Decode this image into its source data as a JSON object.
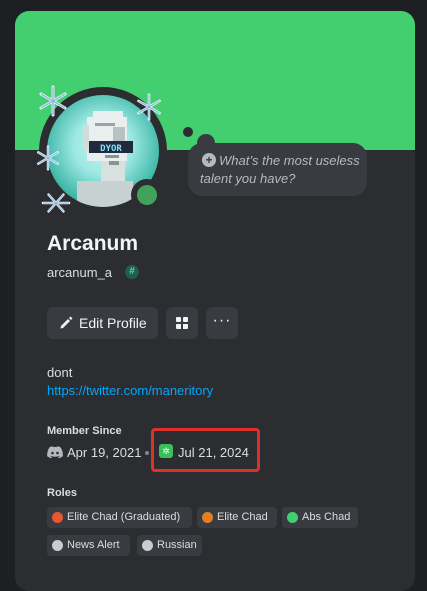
{
  "profile": {
    "display_name": "Arcanum",
    "username": "arcanum_a",
    "username_badge_icon": "hash-badge-icon",
    "status_color": "#43a25a",
    "banner_color": "#43cf70",
    "avatar_text": "DYOR"
  },
  "bubble": {
    "placeholder": "What’s the most useless talent you have?"
  },
  "buttons": {
    "edit_profile": "Edit Profile",
    "more": "···"
  },
  "bio": {
    "text": "dont",
    "link": "https://twitter.com/maneritory"
  },
  "member_since": {
    "title": "Member Since",
    "discord_date": "Apr 19, 2021",
    "server_date": "Jul 21, 2024",
    "highlight_color": "#e0302a"
  },
  "roles": {
    "title": "Roles",
    "items": [
      {
        "label": "Elite Chad (Graduated)",
        "color": "#e8572f"
      },
      {
        "label": "Elite Chad",
        "color": "#e67e22"
      },
      {
        "label": "Abs Chad",
        "color": "#43cf70"
      },
      {
        "label": "News Alert",
        "color": "#c9cdd2"
      },
      {
        "label": "Russian",
        "color": "#c9cdd2"
      }
    ]
  }
}
